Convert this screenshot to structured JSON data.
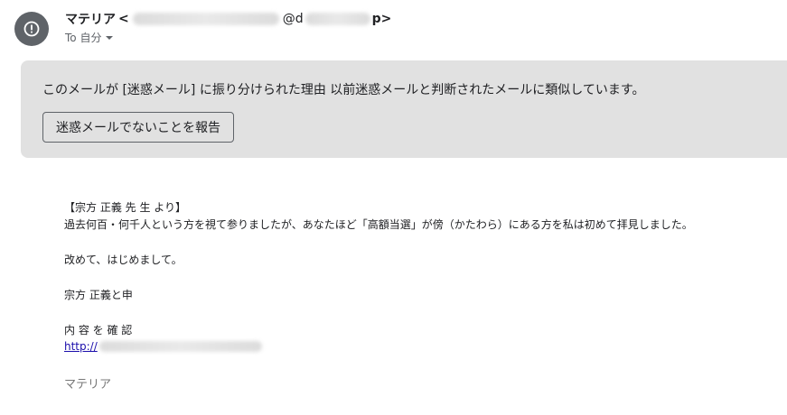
{
  "header": {
    "sender_name": "マテリア",
    "sender_open": "<",
    "sender_at": "@d",
    "sender_tail": "p>",
    "recipient_label": "To 自分"
  },
  "spam_banner": {
    "reason": "このメールが [迷惑メール] に振り分けられた理由 以前迷惑メールと判断されたメールに類似しています。",
    "report_button": "迷惑メールでないことを報告"
  },
  "message": {
    "line1": "【宗方 正義 先 生 より】",
    "line2": "過去何百・何千人という方を視て参りましたが、あなたほど「高額当選」が傍（かたわら）にある方を私は初めて拝見しました。",
    "line3": "改めて、はじめまして。",
    "line4": "宗方 正義と申",
    "line5": "内 容 を 確 認",
    "link_text": "http://",
    "signature": "マテリア"
  },
  "colors": {
    "banner_bg": "#e1e1e1",
    "avatar_bg": "#5f6368",
    "link": "#1a0dab"
  },
  "icons": {
    "avatar": "alert-circle-icon",
    "recipient_caret": "caret-down-icon"
  }
}
